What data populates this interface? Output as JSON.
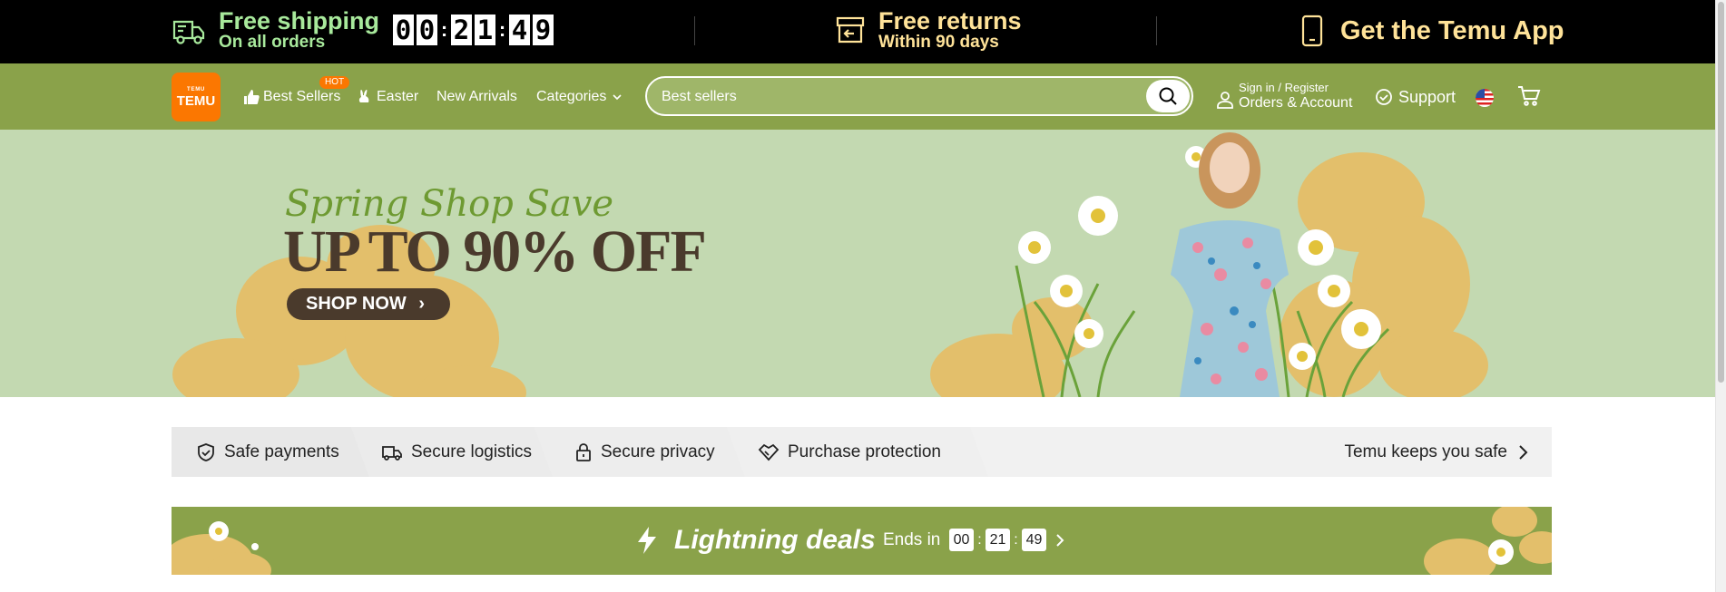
{
  "topbar": {
    "shipping_title": "Free shipping",
    "shipping_sub": "On all orders",
    "timer": [
      "0",
      "0",
      "2",
      "1",
      "4",
      "9"
    ],
    "returns_title": "Free returns",
    "returns_sub": "Within 90 days",
    "app_title": "Get the Temu App",
    "shipping_color": "#a8e99c",
    "promo_color": "#ffe399"
  },
  "nav": {
    "logo_text": "TEMU",
    "logo_glyphs": "ᵀᴱᴹᵁ",
    "best_sellers": "Best Sellers",
    "hot_badge": "HOT",
    "easter": "Easter",
    "new_arrivals": "New Arrivals",
    "categories": "Categories",
    "search_value": "Best sellers",
    "account_line1": "Sign in / Register",
    "account_line2": "Orders & Account",
    "support": "Support",
    "bg_color": "#8aa24a",
    "accent": "#fb7701"
  },
  "hero": {
    "script_text": "Spring Shop Save",
    "headline": "UP TO 90% OFF",
    "cta": "SHOP NOW",
    "bg_color": "#c3d9b1"
  },
  "trust": {
    "items": [
      "Safe payments",
      "Secure logistics",
      "Secure privacy",
      "Purchase protection"
    ],
    "right_link": "Temu keeps you safe"
  },
  "deals": {
    "title": "Lightning deals",
    "ends_label": "Ends in",
    "hours": "00",
    "minutes": "21",
    "seconds": "49"
  }
}
